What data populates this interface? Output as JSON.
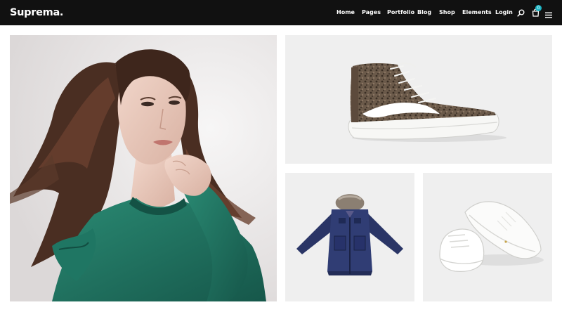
{
  "brand": {
    "logo_text": "Suprema."
  },
  "nav": {
    "items": [
      {
        "label": "Home"
      },
      {
        "label": "Pages"
      },
      {
        "label": "Portfolio"
      },
      {
        "label": "Blog"
      },
      {
        "label": "Shop"
      },
      {
        "label": "Elements"
      },
      {
        "label": "Login"
      }
    ],
    "icons": [
      "search-icon",
      "shopping-bag-icon",
      "hamburger-menu-icon"
    ],
    "cart_count": "0"
  },
  "colors": {
    "navbar": "#111111",
    "accent_badge": "#1fb6c5",
    "tile_background": "#efefef",
    "sweater_green": "#1e6e5c"
  },
  "gallery": {
    "tiles": [
      {
        "subject": "woman in green sweater"
      },
      {
        "subject": "brown high-top sneaker"
      },
      {
        "subject": "navy hooded parka"
      },
      {
        "subject": "white leather sneakers"
      }
    ]
  }
}
